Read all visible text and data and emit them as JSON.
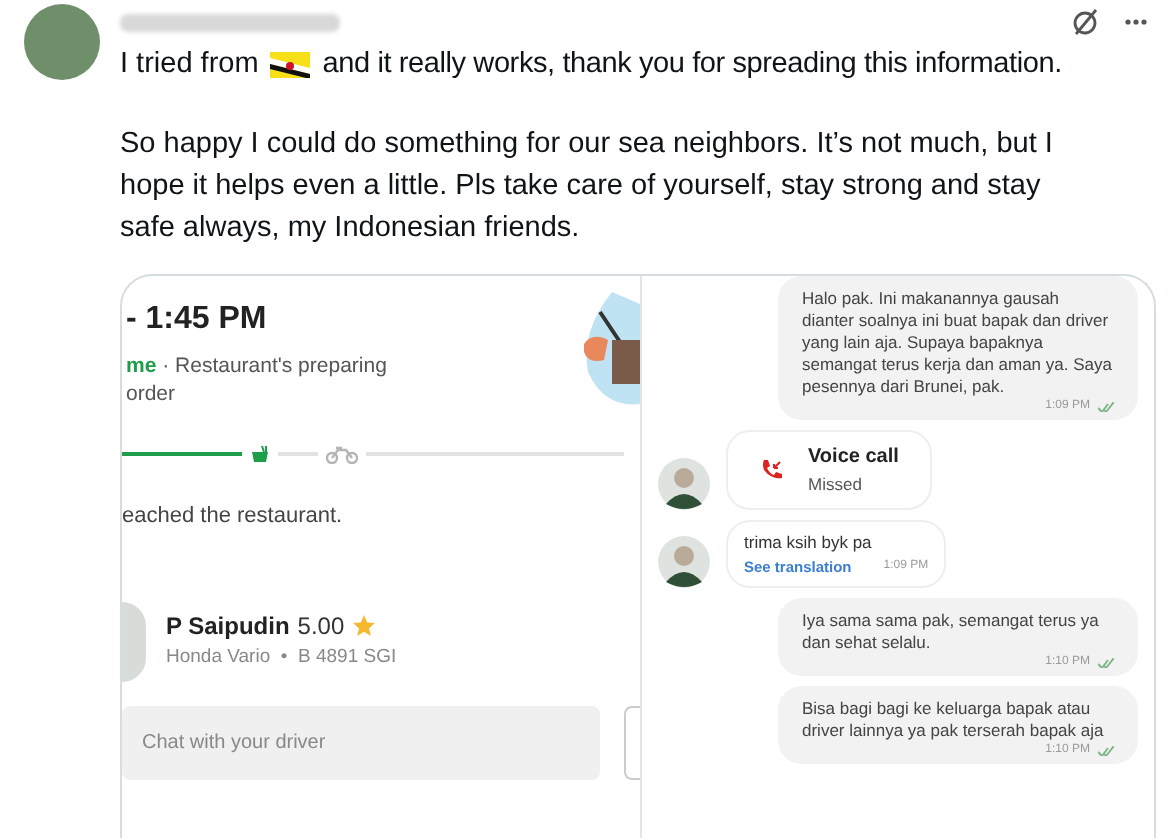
{
  "tweet": {
    "text_before_flag": "I tried from",
    "text_after_flag": "and it really works, thank you for spreading this information.",
    "paragraph": "So happy I could do something for our sea neighbors. It’s not much, but I hope it helps even a little. Pls take care of yourself, stay strong and stay safe always, my Indonesian friends."
  },
  "order": {
    "time": "- 1:45 PM",
    "status_highlight": "me",
    "status_text": "· Restaurant's preparing",
    "status_line2": "order",
    "steps": [
      {
        "kind": "food",
        "done": true
      },
      {
        "kind": "bike",
        "done": false
      }
    ],
    "message": "eached the restaurant.",
    "driver": {
      "name": "P Saipudin",
      "rating": "5.00",
      "vehicle": "Honda Vario  •  B 4891 SGI"
    },
    "chat_field": {
      "placeholder": "Chat with your driver"
    }
  },
  "chat": [
    {
      "kind": "sent",
      "text": "Halo pak. Ini makanannya gausah dianter soalnya ini buat bapak dan driver yang lain aja. Supaya bapaknya semangat terus kerja dan aman ya. Saya pesennya dari Brunei, pak.",
      "time": "1:09 PM"
    },
    {
      "kind": "call",
      "title": "Voice call",
      "subtitle": "Missed"
    },
    {
      "kind": "received",
      "text": "trima ksih byk pa",
      "link": "See translation",
      "time": "1:09 PM"
    },
    {
      "kind": "sent",
      "text": "Iya sama sama pak, semangat terus ya dan sehat selalu.",
      "time": "1:10 PM"
    },
    {
      "kind": "sent",
      "text": "Bisa bagi bagi ke keluarga bapak atau driver lainnya ya pak terserah bapak aja",
      "time": "1:10 PM"
    }
  ]
}
